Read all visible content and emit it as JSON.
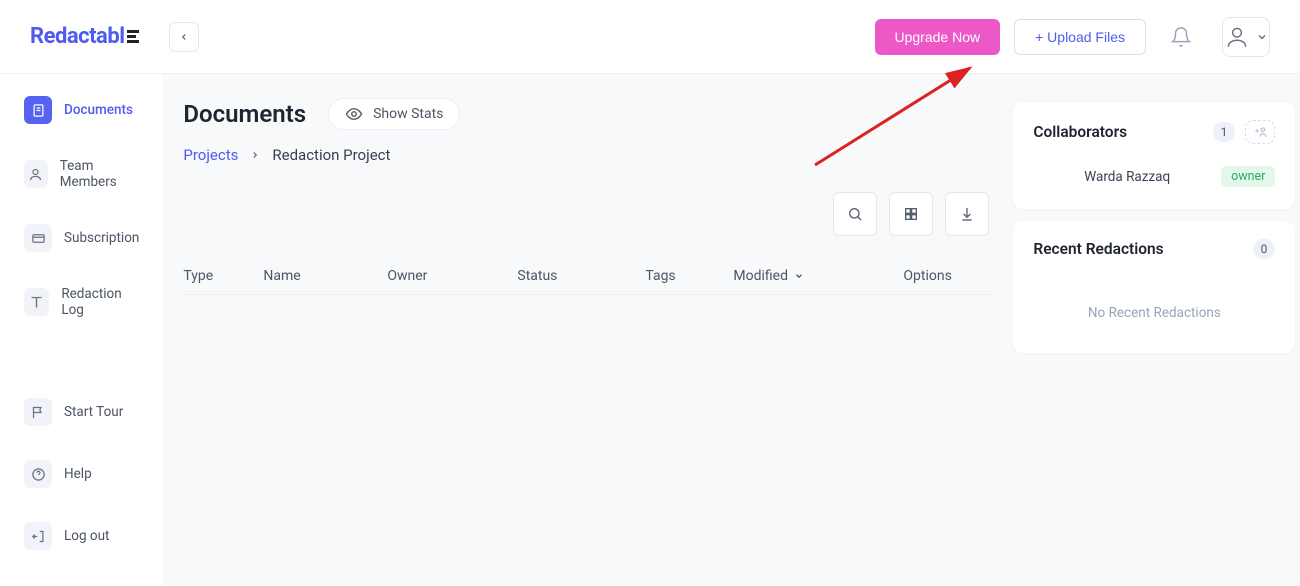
{
  "brand": "Redactabl",
  "header": {
    "upgrade_label": "Upgrade Now",
    "upload_label": "+ Upload Files"
  },
  "sidebar": {
    "items": [
      {
        "label": "Documents",
        "icon": "document-icon",
        "active": true
      },
      {
        "label": "Team Members",
        "icon": "user-icon",
        "active": false
      },
      {
        "label": "Subscription",
        "icon": "card-icon",
        "active": false
      },
      {
        "label": "Redaction Log",
        "icon": "book-icon",
        "active": false
      }
    ],
    "footer_items": [
      {
        "label": "Start Tour",
        "icon": "flag-icon"
      },
      {
        "label": "Help",
        "icon": "help-icon"
      },
      {
        "label": "Log out",
        "icon": "logout-icon"
      }
    ]
  },
  "page": {
    "title": "Documents",
    "show_stats_label": "Show Stats",
    "breadcrumb": {
      "root": "Projects",
      "current": "Redaction Project"
    },
    "columns": {
      "type": "Type",
      "name": "Name",
      "owner": "Owner",
      "status": "Status",
      "tags": "Tags",
      "modified": "Modified",
      "options": "Options"
    },
    "rows": []
  },
  "collaborators": {
    "title": "Collaborators",
    "count": "1",
    "items": [
      {
        "name": "Warda Razzaq",
        "role": "owner"
      }
    ]
  },
  "recent": {
    "title": "Recent Redactions",
    "count": "0",
    "empty": "No Recent Redactions"
  }
}
